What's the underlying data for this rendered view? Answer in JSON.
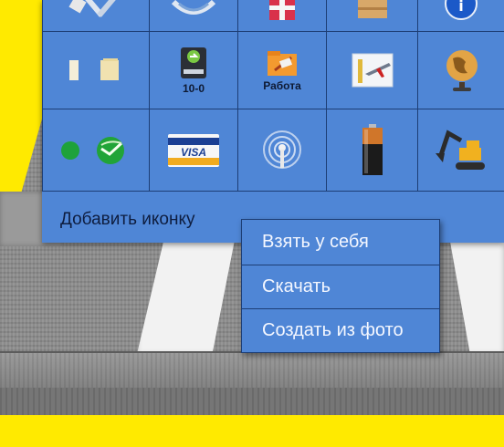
{
  "icon_grid": {
    "rows": [
      [
        {
          "name": "tools-icon",
          "label": ""
        },
        {
          "name": "disc-icon",
          "label": ""
        },
        {
          "name": "gift-icon",
          "label": ""
        },
        {
          "name": "box-icon",
          "label": ""
        },
        {
          "name": "info-icon",
          "label": ""
        }
      ],
      [
        {
          "name": "documents-icon",
          "label": ""
        },
        {
          "name": "backup-drive-icon",
          "label": "10-0"
        },
        {
          "name": "work-folder-icon",
          "label": "Работа"
        },
        {
          "name": "flight-icon",
          "label": ""
        },
        {
          "name": "globe-icon",
          "label": ""
        }
      ],
      [
        {
          "name": "sberbank-icon",
          "label": ""
        },
        {
          "name": "visa-card-icon",
          "label": ""
        },
        {
          "name": "wifi-antenna-icon",
          "label": ""
        },
        {
          "name": "battery-icon",
          "label": ""
        },
        {
          "name": "excavator-icon",
          "label": ""
        }
      ]
    ],
    "visa_text": "VISA"
  },
  "add_icon_label": "Добавить иконку",
  "context_menu": {
    "items": [
      "Взять у себя",
      "Скачать",
      "Создать из фото"
    ]
  },
  "colors": {
    "panel": "#4f86d6",
    "panel_border": "#1d3e75",
    "background_yellow": "#ffea00"
  }
}
